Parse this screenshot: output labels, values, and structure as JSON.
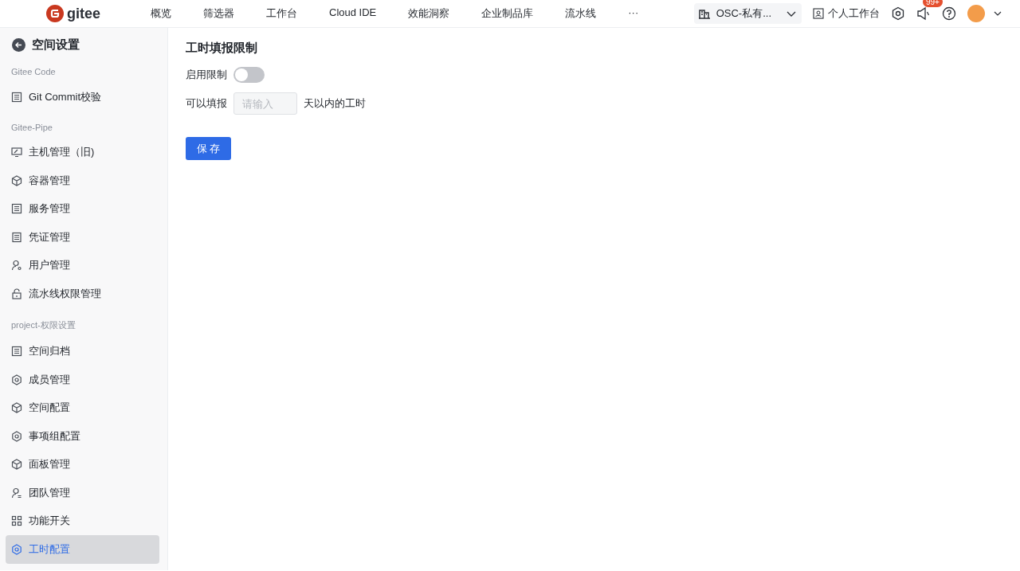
{
  "header": {
    "logo": "gitee",
    "nav": [
      "概览",
      "筛选器",
      "工作台",
      "Cloud IDE",
      "效能洞察",
      "企业制品库",
      "流水线",
      "···"
    ],
    "org": "OSC-私有...",
    "workspace": "个人工作台",
    "badge": "99+"
  },
  "sidebar": {
    "title": "空间设置",
    "groups": [
      {
        "label": "Gitee Code",
        "items": [
          {
            "label": "Git Commit校验",
            "selected": false
          }
        ]
      },
      {
        "label": "Gitee-Pipe",
        "items": [
          {
            "label": "主机管理（旧)",
            "selected": false
          },
          {
            "label": "容器管理",
            "selected": false
          },
          {
            "label": "服务管理",
            "selected": false
          },
          {
            "label": "凭证管理",
            "selected": false
          },
          {
            "label": "用户管理",
            "selected": false
          },
          {
            "label": "流水线权限管理",
            "selected": false
          }
        ]
      },
      {
        "label": "project-权限设置",
        "items": [
          {
            "label": "空间归档",
            "selected": false
          },
          {
            "label": "成员管理",
            "selected": false
          },
          {
            "label": "空间配置",
            "selected": false
          },
          {
            "label": "事项组配置",
            "selected": false
          },
          {
            "label": "面板管理",
            "selected": false
          },
          {
            "label": "团队管理",
            "selected": false
          },
          {
            "label": "功能开关",
            "selected": false
          },
          {
            "label": "工时配置",
            "selected": true
          }
        ]
      }
    ]
  },
  "main": {
    "title": "工时填报限制",
    "switch_label": "启用限制",
    "switch_on": false,
    "prefix": "可以填报",
    "placeholder": "请输入",
    "suffix": "天以内的工时",
    "save": "保 存"
  }
}
